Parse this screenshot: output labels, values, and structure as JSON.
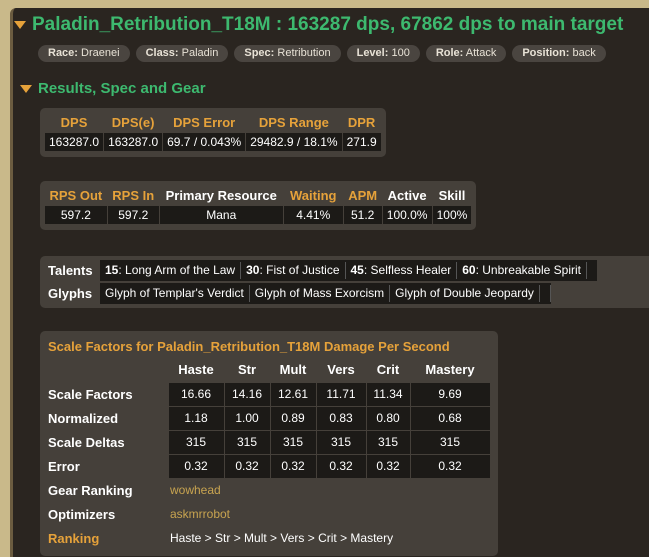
{
  "header": {
    "title": "Paladin_Retribution_T18M : 163287 dps, 67862 dps to main target",
    "tags": [
      {
        "label": "Race:",
        "value": "Draenei"
      },
      {
        "label": "Class:",
        "value": "Paladin"
      },
      {
        "label": "Spec:",
        "value": "Retribution"
      },
      {
        "label": "Level:",
        "value": "100"
      },
      {
        "label": "Role:",
        "value": "Attack"
      },
      {
        "label": "Position:",
        "value": "back"
      }
    ]
  },
  "section": {
    "title": "Results, Spec and Gear"
  },
  "dps_table": {
    "headers": [
      "DPS",
      "DPS(e)",
      "DPS Error",
      "DPS Range",
      "DPR"
    ],
    "values": [
      "163287.0",
      "163287.0",
      "69.7 / 0.043%",
      "29482.9 / 18.1%",
      "271.9"
    ]
  },
  "resource_table": {
    "headers": [
      "RPS Out",
      "RPS In",
      "Primary Resource",
      "Waiting",
      "APM",
      "Active",
      "Skill"
    ],
    "values": [
      "597.2",
      "597.2",
      "Mana",
      "4.41%",
      "51.2",
      "100.0%",
      "100%"
    ]
  },
  "talents": {
    "label": "Talents",
    "items": [
      {
        "level": "15",
        "name": "Long Arm of the Law"
      },
      {
        "level": "30",
        "name": "Fist of Justice"
      },
      {
        "level": "45",
        "name": "Selfless Healer"
      },
      {
        "level": "60",
        "name": "Unbreakable Spirit"
      }
    ]
  },
  "glyphs": {
    "label": "Glyphs",
    "items": [
      "Glyph of Templar's Verdict",
      "Glyph of Mass Exorcism",
      "Glyph of Double Jeopardy"
    ]
  },
  "scale_factors": {
    "title": "Scale Factors for Paladin_Retribution_T18M Damage Per Second",
    "columns": [
      "Haste",
      "Str",
      "Mult",
      "Vers",
      "Crit",
      "Mastery"
    ],
    "rows": [
      {
        "label": "Scale Factors",
        "values": [
          "16.66",
          "14.16",
          "12.61",
          "11.71",
          "11.34",
          "9.69"
        ]
      },
      {
        "label": "Normalized",
        "values": [
          "1.18",
          "1.00",
          "0.89",
          "0.83",
          "0.80",
          "0.68"
        ]
      },
      {
        "label": "Scale Deltas",
        "values": [
          "315",
          "315",
          "315",
          "315",
          "315",
          "315"
        ]
      },
      {
        "label": "Error",
        "values": [
          "0.32",
          "0.32",
          "0.32",
          "0.32",
          "0.32",
          "0.32"
        ]
      }
    ],
    "gear_ranking": {
      "label": "Gear Ranking",
      "value": "wowhead"
    },
    "optimizers": {
      "label": "Optimizers",
      "value": "askmrrobot"
    },
    "ranking": {
      "label": "Ranking",
      "value": "Haste > Str > Mult > Vers > Crit > Mastery"
    }
  },
  "colors": {
    "accent_green": "#3db96f",
    "accent_orange": "#e6a23a",
    "panel": "#45403a",
    "background": "#2a2520"
  }
}
